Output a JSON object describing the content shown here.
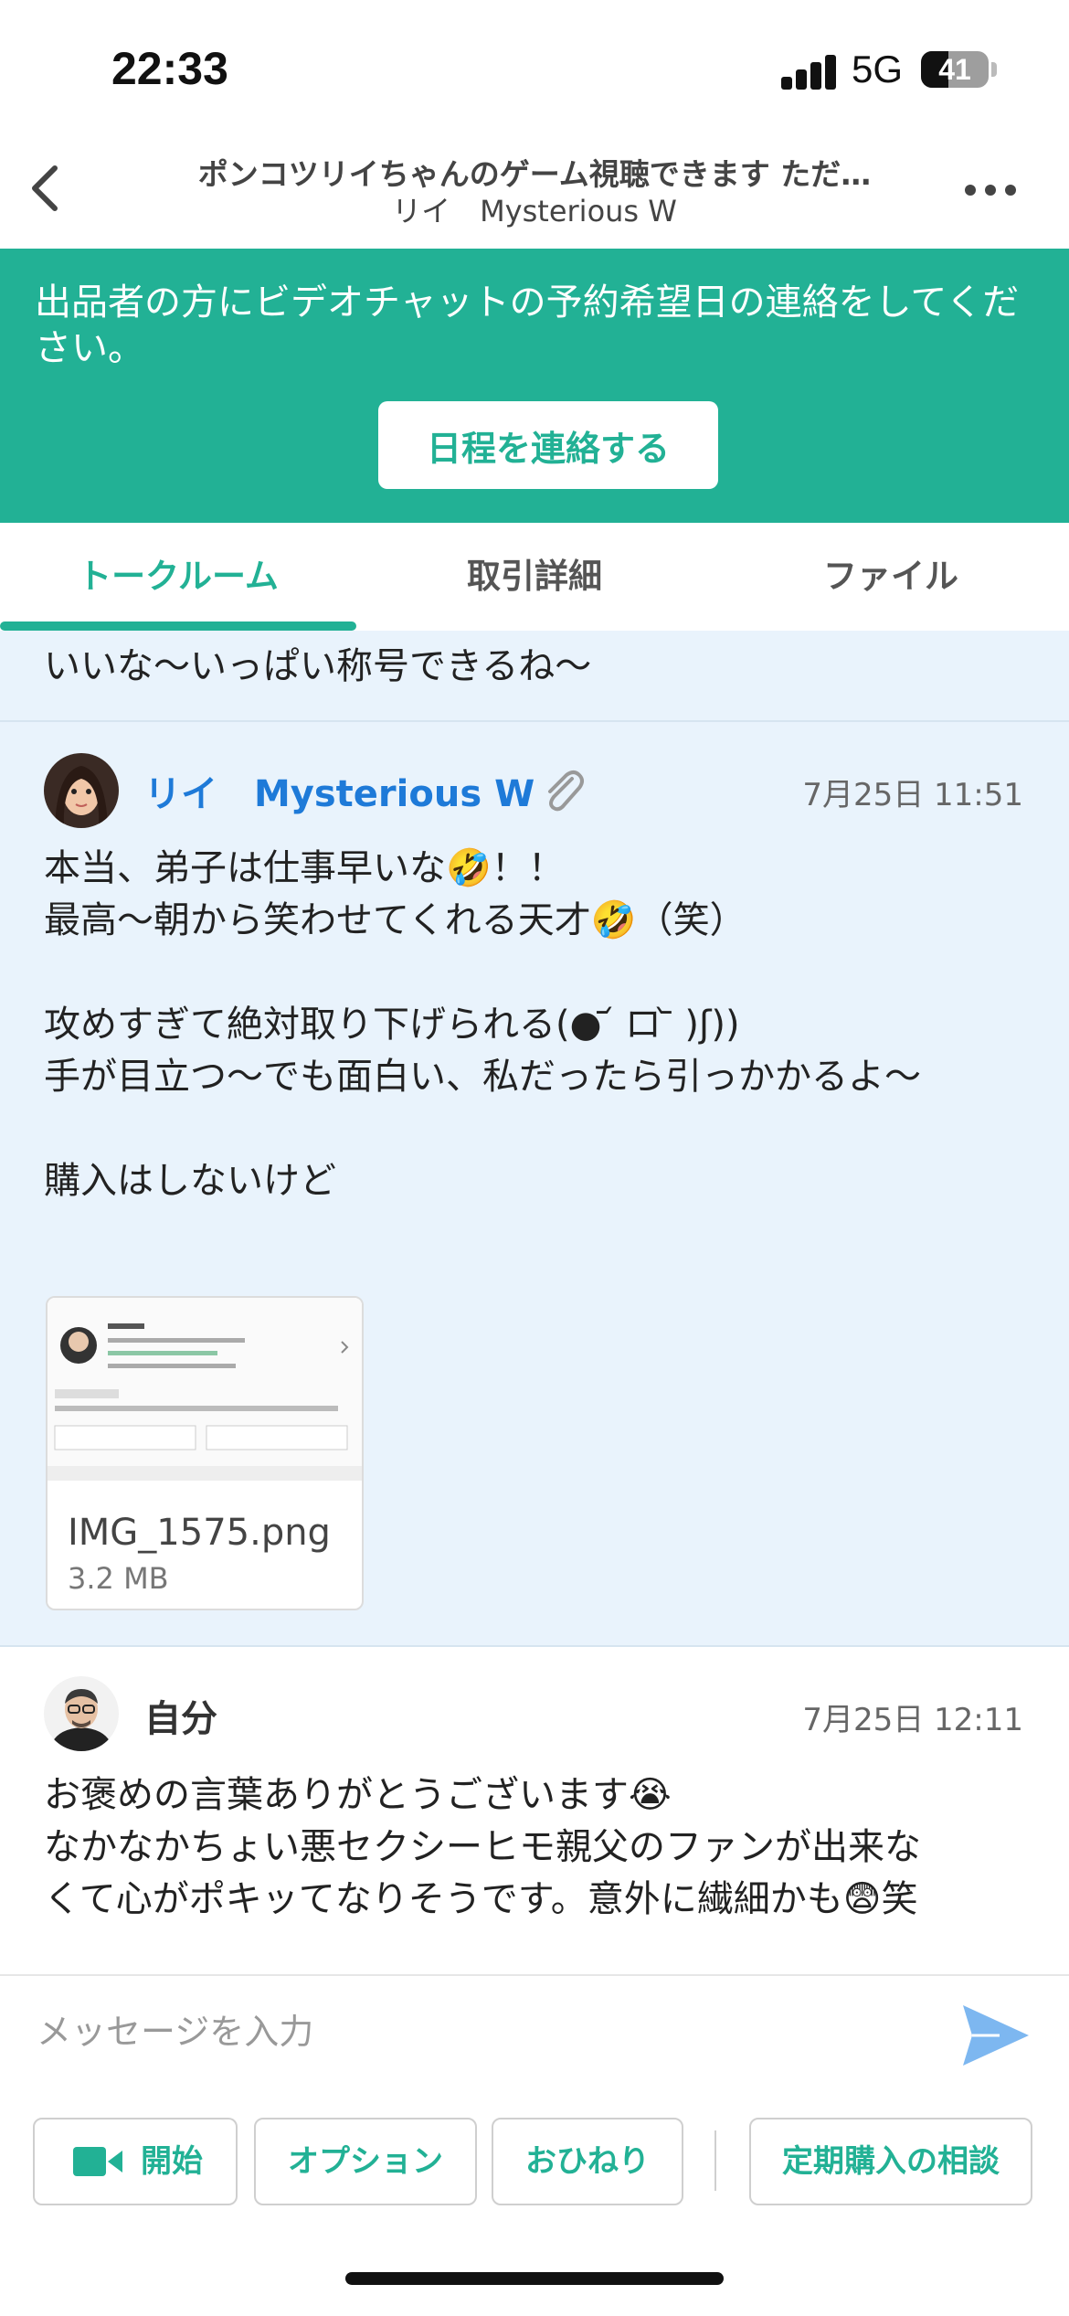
{
  "status_bar": {
    "time": "22:33",
    "network": "5G",
    "battery": "41",
    "battery_level": 0.41
  },
  "header": {
    "title": "ポンコツリイちゃんのゲーム視聴できます ただ…",
    "subtitle": "リイ　Mysterious W"
  },
  "banner": {
    "text": "出品者の方にビデオチャットの予約希望日の連絡をしてください。",
    "button": "日程を連絡する"
  },
  "tabs": [
    {
      "label": "トークルーム",
      "active": true
    },
    {
      "label": "取引詳細",
      "active": false
    },
    {
      "label": "ファイル",
      "active": false
    }
  ],
  "messages": [
    {
      "partial_text": "いいな〜いっぱい称号できるね〜"
    },
    {
      "sender": "リイ　Mysterious W",
      "timestamp": "7月25日 11:51",
      "text": "本当、弟子は仕事早いな🤣！！\n最高〜朝から笑わせてくれる天才🤣（笑）\n\n攻めすぎて絶対取り下げられる(● ᷄ ロ ᷅ )ʃ))\n手が目立つ〜でも面白い、私だったら引っかかるよ〜\n\n購入はしないけど",
      "attachment": {
        "name": "IMG_1575.png",
        "size": "3.2 MB"
      }
    },
    {
      "sender": "自分",
      "timestamp": "7月25日 12:11",
      "text": "お褒めの言葉ありがとうございます😭\nなかなかちょい悪セクシーヒモ親父のファンが出来な\nくて心がポキッてなりそうです。意外に繊細かも😨笑"
    }
  ],
  "input": {
    "placeholder": "メッセージを入力"
  },
  "actions": [
    {
      "label": "開始",
      "icon": "video-camera-icon"
    },
    {
      "label": "オプション"
    },
    {
      "label": "おひねり"
    },
    {
      "label": "定期購入の相談"
    }
  ],
  "colors": {
    "accent": "#22b195",
    "link": "#1e7ad8",
    "chat_bg": "#e9f3fc"
  }
}
